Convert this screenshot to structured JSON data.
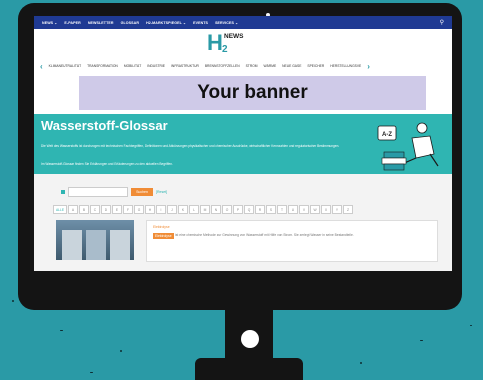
{
  "topnav": {
    "items": [
      "NEWS ⌄",
      "E-PAPER",
      "NEWSLETTER",
      "GLOSSAR",
      "H2-MARKTSPIEGEL ⌄",
      "EVENTS",
      "SERVICES ⌄"
    ],
    "search_icon": "search-icon"
  },
  "logo": {
    "h": "H",
    "two": "2",
    "news": "NEWS"
  },
  "categories": {
    "items": [
      "KLIMANEUTRALITÄT",
      "TRANSFORMATION",
      "MOBILITÄT",
      "INDUSTRIE",
      "INFRASTRUKTUR",
      "BRENNSTOFFZELLEN",
      "STROM",
      "WÄRME",
      "NEUE GASE",
      "SPEICHER",
      "HERSTELLUNGSVE"
    ],
    "prev_icon": "chevron-left-icon",
    "next_icon": "chevron-right-icon"
  },
  "banner": {
    "text": "Your banner"
  },
  "hero": {
    "title": "Wasserstoff-Glossar",
    "para1": "Die Welt des Wasserstoffs ist durchzogen mit technischen Fachbegriffen, Definitionen und Abkürzungen physikalischer und chemischer Ausdrücke, wirtschaftlicher Kennzahlen und regulatorischer Bestimmungen.",
    "para2": "Im Wasserstoff-Glossar finden Sie Erklärungen und Erläuterungen zu den aktuellen Begriffen.",
    "badge": "A-Z"
  },
  "search": {
    "button": "Suchen",
    "reset": "[Reset]"
  },
  "alphabet": [
    "ALLE",
    "A",
    "B",
    "C",
    "D",
    "E",
    "F",
    "G",
    "H",
    "I",
    "J",
    "K",
    "L",
    "M",
    "N",
    "O",
    "P",
    "Q",
    "R",
    "S",
    "T",
    "U",
    "V",
    "W",
    "X",
    "Y",
    "Z"
  ],
  "entry": {
    "tag": "Elektrolyse",
    "label": "Elektrolyse",
    "text": "ist eine chemische Methode zur Gewinnung von Wasserstoff mit Hilfe von Strom. Sie zerlegt Wasser in seine Bestandteile."
  },
  "colors": {
    "accent": "#2fb5b2",
    "nav": "#1f3a93",
    "banner": "#cfcae8",
    "button": "#f08c36"
  }
}
